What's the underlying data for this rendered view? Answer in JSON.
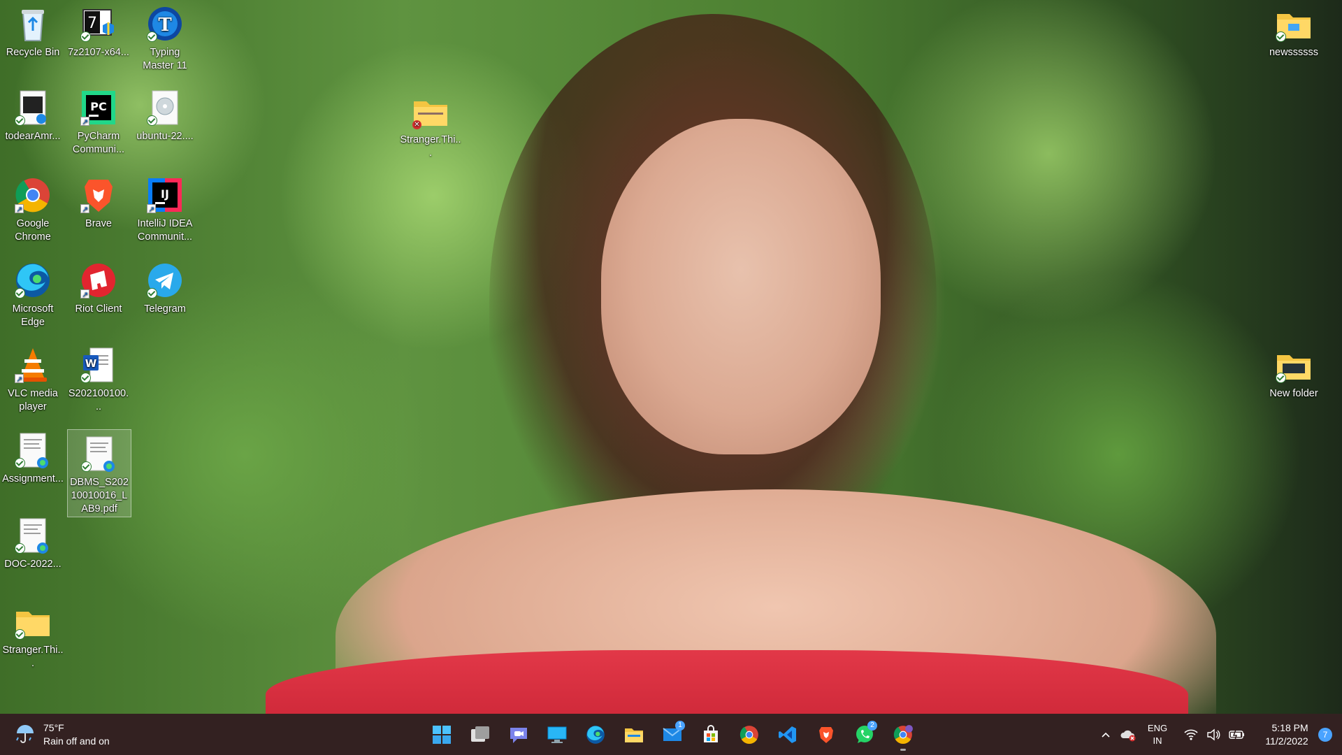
{
  "desktop": {
    "icons": [
      {
        "label": "Recycle Bin",
        "icon": "recycle-bin-icon",
        "badge": "none"
      },
      {
        "label": "7z2107-x64...",
        "icon": "7zip-installer-icon",
        "badge": "sync"
      },
      {
        "label": "Typing Master 11",
        "icon": "typing-master-icon",
        "badge": "sync"
      },
      {
        "label": "todearAmr...",
        "icon": "document-icon",
        "badge": "sync"
      },
      {
        "label": "PyCharm Communi...",
        "icon": "pycharm-icon",
        "badge": "shortcut"
      },
      {
        "label": "ubuntu-22....",
        "icon": "disc-image-icon",
        "badge": "sync"
      },
      {
        "label": "Stranger.Thi...",
        "icon": "zip-folder-icon",
        "badge": "error"
      },
      {
        "label": "Google Chrome",
        "icon": "chrome-icon",
        "badge": "shortcut"
      },
      {
        "label": "Brave",
        "icon": "brave-icon",
        "badge": "shortcut"
      },
      {
        "label": "IntelliJ IDEA Communit...",
        "icon": "intellij-icon",
        "badge": "shortcut"
      },
      {
        "label": "Microsoft Edge",
        "icon": "edge-icon",
        "badge": "sync"
      },
      {
        "label": "Riot Client",
        "icon": "riot-client-icon",
        "badge": "shortcut"
      },
      {
        "label": "Telegram",
        "icon": "telegram-icon",
        "badge": "sync"
      },
      {
        "label": "VLC media player",
        "icon": "vlc-icon",
        "badge": "shortcut"
      },
      {
        "label": "S202100100...",
        "icon": "word-document-icon",
        "badge": "sync"
      },
      {
        "label": "Assignment...",
        "icon": "pdf-edge-icon",
        "badge": "sync"
      },
      {
        "label": "DBMS_S20210010016_LAB9.pdf",
        "icon": "pdf-edge-icon",
        "badge": "sync",
        "selected": true
      },
      {
        "label": "DOC-2022...",
        "icon": "pdf-edge-icon",
        "badge": "sync"
      },
      {
        "label": "Stranger.Thi...",
        "icon": "folder-icon",
        "badge": "sync"
      },
      {
        "label": "newssssss",
        "icon": "folder-icon",
        "badge": "sync"
      },
      {
        "label": "New folder",
        "icon": "folder-icon",
        "badge": "sync"
      }
    ]
  },
  "taskbar": {
    "weather": {
      "temp": "75°F",
      "condition": "Rain off and on",
      "icon": "umbrella-rain-icon"
    },
    "apps": [
      {
        "name": "start",
        "icon": "windows-start-icon"
      },
      {
        "name": "task-view",
        "icon": "task-view-icon"
      },
      {
        "name": "teams-chat",
        "icon": "teams-chat-icon"
      },
      {
        "name": "desktop",
        "icon": "monitor-icon"
      },
      {
        "name": "edge",
        "icon": "edge-icon"
      },
      {
        "name": "file-explorer",
        "icon": "file-explorer-icon"
      },
      {
        "name": "mail",
        "icon": "mail-icon",
        "badge": "1"
      },
      {
        "name": "microsoft-store",
        "icon": "store-icon"
      },
      {
        "name": "chrome",
        "icon": "chrome-icon"
      },
      {
        "name": "vscode",
        "icon": "vscode-icon"
      },
      {
        "name": "brave",
        "icon": "brave-icon"
      },
      {
        "name": "whatsapp",
        "icon": "whatsapp-icon",
        "badge": "2"
      },
      {
        "name": "chrome-profile",
        "icon": "chrome-profile-icon",
        "running": true
      }
    ],
    "tray": {
      "lang_top": "ENG",
      "lang_bottom": "IN",
      "time": "5:18 PM",
      "date": "11/2/2022",
      "notifications": "7"
    }
  },
  "colors": {
    "taskbar_bg": "#2c1a1a",
    "accent_blue": "#4aa3ff",
    "folder_yellow": "#f4c542"
  }
}
